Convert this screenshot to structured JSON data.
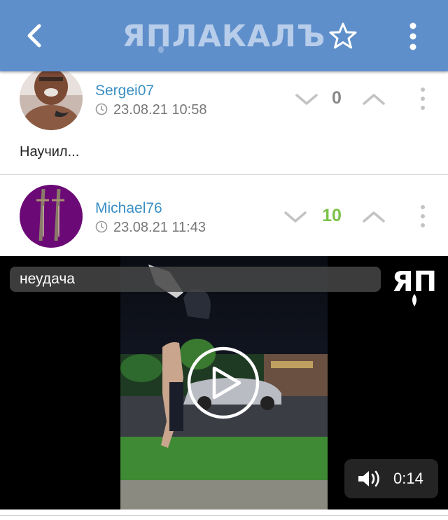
{
  "header": {
    "logo_text": "ЯПЛАКАЛЪ",
    "back_icon": "back-arrow-icon",
    "star_icon": "star-outline-icon",
    "menu_icon": "more-vertical-icon",
    "bar_color": "#5f8fcb"
  },
  "comments": [
    {
      "username": "Sergei07",
      "time": "23.08.21 10:58",
      "score": "0",
      "score_color": "#888888",
      "text": "Научил..."
    },
    {
      "username": "Michael76",
      "time": "23.08.21 11:43",
      "score": "10",
      "score_color": "#7cc24a"
    }
  ],
  "video": {
    "caption": "неудача",
    "watermark": "ЯП",
    "duration": "0:14",
    "volume_icon": "speaker-icon",
    "play_icon": "play-icon"
  }
}
